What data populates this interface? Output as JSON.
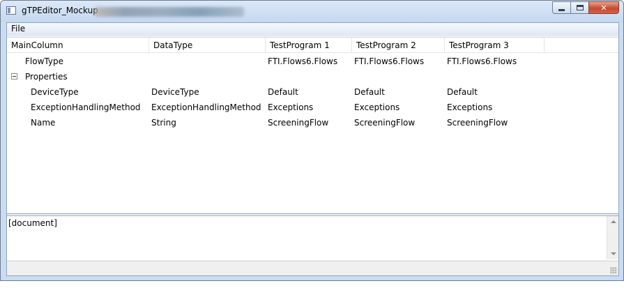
{
  "window": {
    "title": "gTPEditor_Mockup"
  },
  "menu": {
    "file": "File"
  },
  "grid": {
    "columns": [
      "MainColumn",
      "DataType",
      "TestProgram 1",
      "TestProgram 2",
      "TestProgram 3"
    ],
    "rows": [
      {
        "main": "FlowType",
        "datatype": "",
        "tp1": "FTI.Flows6.Flows",
        "tp2": "FTI.Flows6.Flows",
        "tp3": "FTI.Flows6.Flows"
      },
      {
        "main": "Properties",
        "datatype": "",
        "tp1": "",
        "tp2": "",
        "tp3": ""
      },
      {
        "main": "DeviceType",
        "datatype": "DeviceType",
        "tp1": "Default",
        "tp2": "Default",
        "tp3": "Default"
      },
      {
        "main": "ExceptionHandlingMethod",
        "datatype": "ExceptionHandlingMethod",
        "tp1": "Exceptions",
        "tp2": "Exceptions",
        "tp3": "Exceptions"
      },
      {
        "main": "Name",
        "datatype": "String",
        "tp1": "ScreeningFlow",
        "tp2": "ScreeningFlow",
        "tp3": "ScreeningFlow"
      }
    ]
  },
  "document_pane": {
    "text": "[document]"
  },
  "colors": {
    "title_gradient_top": "#dbe8f8",
    "close_button": "#c74a30"
  },
  "icons": [
    "app-icon",
    "minimize-icon",
    "maximize-icon",
    "close-icon",
    "collapse-icon",
    "scroll-up-icon",
    "scroll-down-icon",
    "resize-grip-icon"
  ]
}
